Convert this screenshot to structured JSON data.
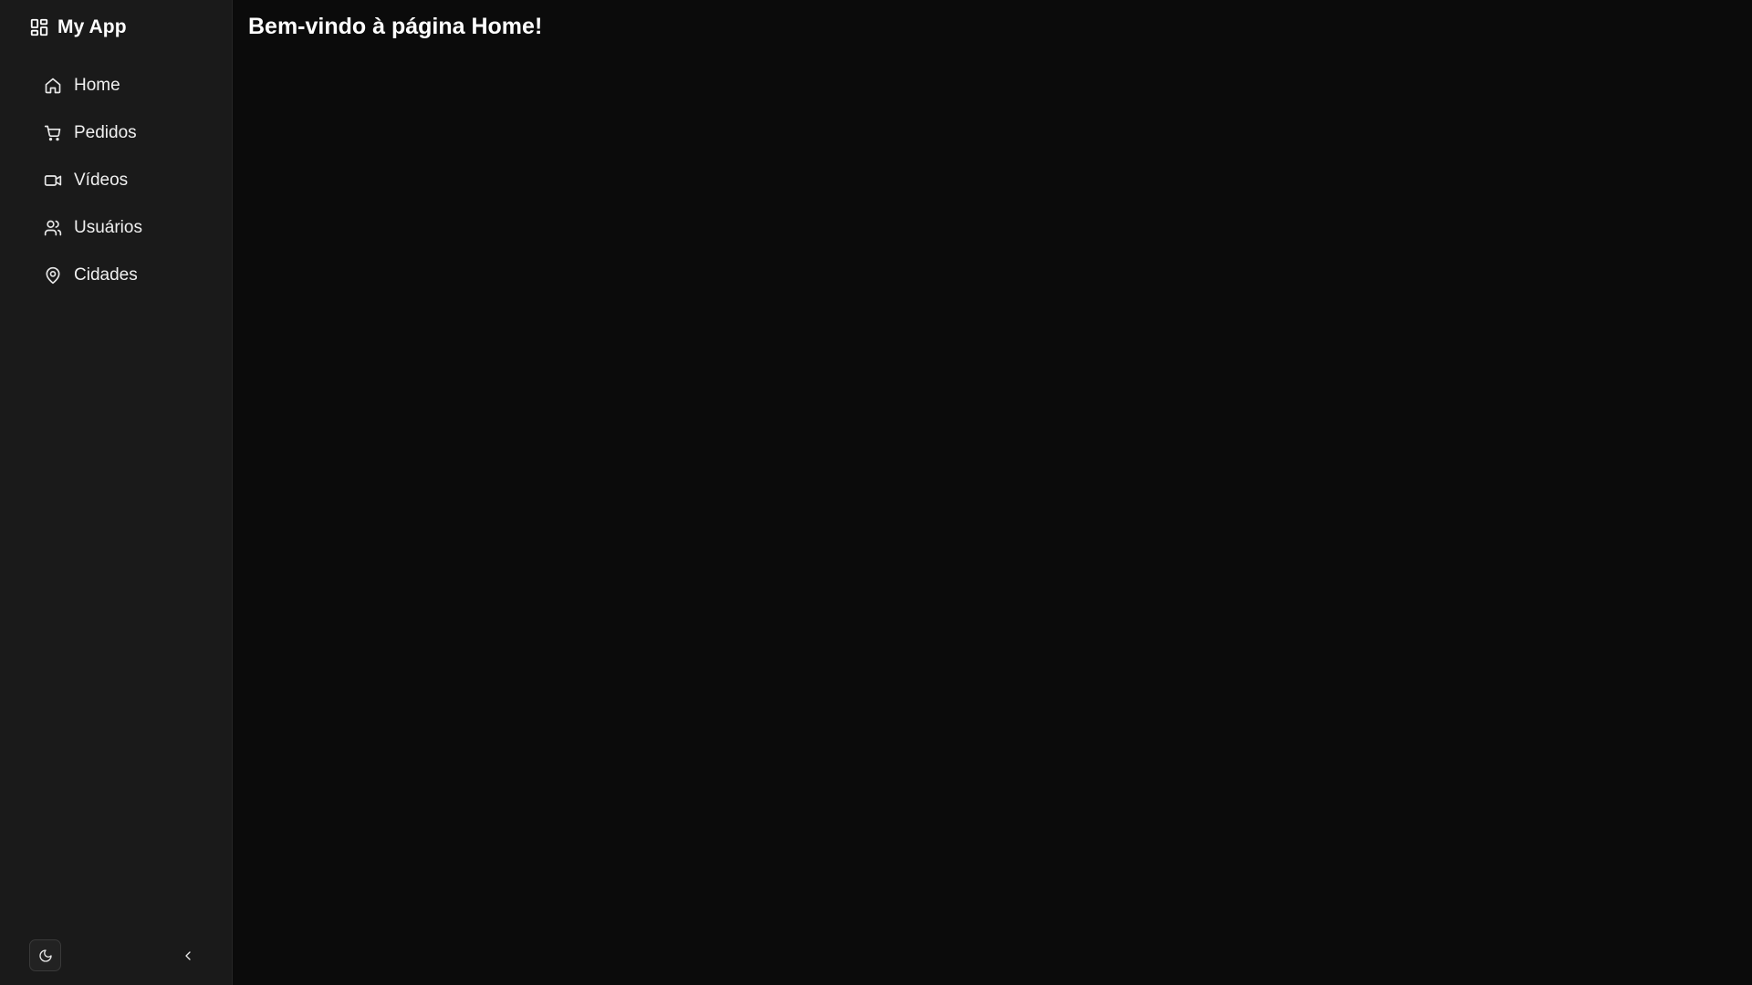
{
  "app": {
    "title": "My App",
    "brand_icon": "dashboard-grid-icon"
  },
  "sidebar": {
    "items": [
      {
        "label": "Home",
        "icon": "home-icon"
      },
      {
        "label": "Pedidos",
        "icon": "shopping-cart-icon"
      },
      {
        "label": "Vídeos",
        "icon": "video-camera-icon"
      },
      {
        "label": "Usuários",
        "icon": "users-icon"
      },
      {
        "label": "Cidades",
        "icon": "map-pin-icon"
      }
    ],
    "footer": {
      "theme_toggle_icon": "moon-icon",
      "collapse_icon": "chevron-left-icon"
    }
  },
  "main": {
    "title": "Bem-vindo à página Home!"
  },
  "colors": {
    "sidebar_bg": "#1a1a1a",
    "main_bg": "#0b0b0b",
    "text": "#f2f2f2"
  }
}
